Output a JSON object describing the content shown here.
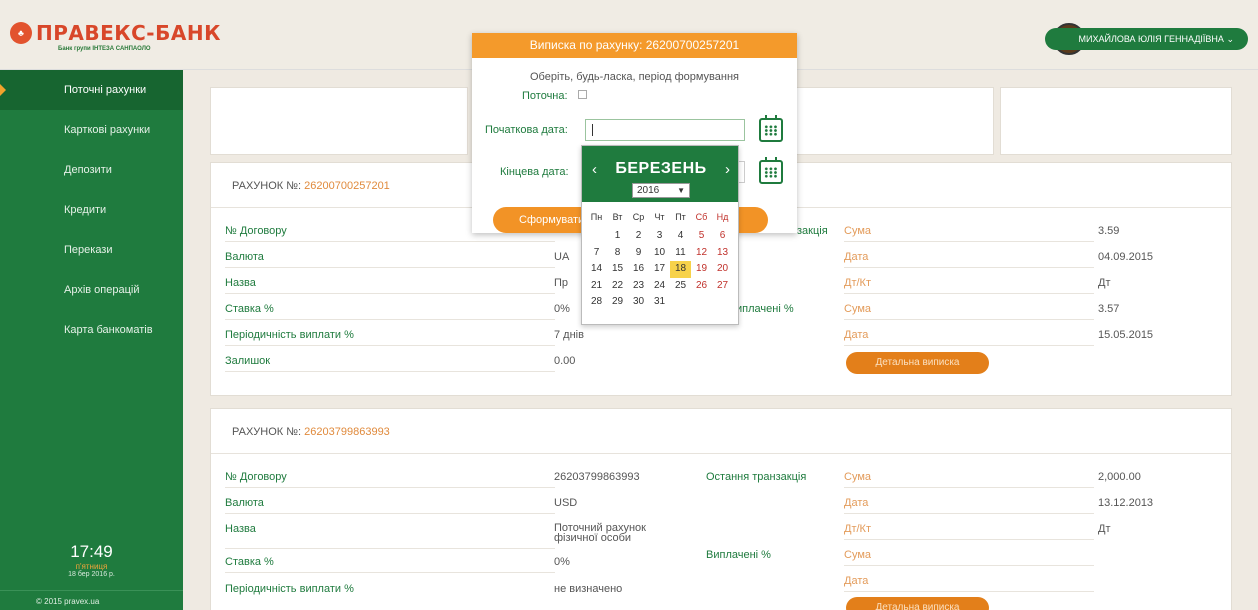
{
  "header": {
    "bank_name": "ПРАВЕКС-БАНК",
    "bank_tagline": "Банк групи ІНТЕЗА САНПАОЛО",
    "user_name": "МИХАЙЛОВА ЮЛІЯ ГЕННАДІЇВНА"
  },
  "sidebar": {
    "items": [
      {
        "label": "Поточні рахунки"
      },
      {
        "label": "Карткові рахунки"
      },
      {
        "label": "Депозити"
      },
      {
        "label": "Кредити"
      },
      {
        "label": "Перекази"
      },
      {
        "label": "Архів операцій"
      },
      {
        "label": "Карта банкоматів"
      }
    ],
    "clock_time": "17:49",
    "clock_day": "п'ятниця",
    "clock_date": "18 бер 2016 р.",
    "copyright": "© 2015 pravex.ua"
  },
  "accounts": [
    {
      "title": "РАХУНОК №:",
      "number": "26200700257201",
      "contract_label": "№ Договору",
      "currency_label": "Валюта",
      "currency_value": "UA",
      "name_label": "Назва",
      "name_value": "Пр",
      "rate_label": "Ставка %",
      "rate_value": "0%",
      "period_label": "Періодичність виплати %",
      "period_value": "7 днів",
      "balance_label": "Залишок",
      "balance_value": "0.00",
      "last_tx_label": "закція",
      "paid_label": "иплачені %",
      "sum_label": "Сума",
      "sum_value": "3.59",
      "date_label": "Дата",
      "date_value": "04.09.2015",
      "dtkt_label": "Дт/Кт",
      "dtkt_value": "Дт",
      "paid_sum_label": "Сума",
      "paid_sum_value": "3.57",
      "paid_date_label": "Дата",
      "paid_date_value": "15.05.2015",
      "detail_button": "Детальна виписка"
    },
    {
      "title": "РАХУНОК №:",
      "number": "26203799863993",
      "contract_label": "№ Договору",
      "contract_value": "26203799863993",
      "currency_label": "Валюта",
      "currency_value": "USD",
      "name_label": "Назва",
      "name_value_1": "Поточний рахунок",
      "name_value_2": "фізичної особи",
      "rate_label": "Ставка %",
      "rate_value": "0%",
      "period_label": "Періодичність виплати %",
      "period_value": "не визначено",
      "last_tx_label": "Остання транзакція",
      "paid_label": "Виплачені %",
      "sum_label": "Сума",
      "sum_value": "2,000.00",
      "date_label": "Дата",
      "date_value": "13.12.2013",
      "dtkt_label": "Дт/Кт",
      "dtkt_value": "Дт",
      "paid_sum_label": "Сума",
      "paid_date_label": "Дата",
      "detail_button": "Детальна виписка"
    }
  ],
  "modal": {
    "title": "Виписка по рахунку: 26200700257201",
    "subtitle": "Оберіть, будь-ласка, період формування",
    "current_label": "Поточна:",
    "start_label": "Початкова дата:",
    "end_label": "Кінцева дата:",
    "submit_label": "Сформувати"
  },
  "datepicker": {
    "month": "БЕРЕЗЕНЬ",
    "year": "2016",
    "weekdays": [
      "Пн",
      "Вт",
      "Ср",
      "Чт",
      "Пт",
      "Сб",
      "Нд"
    ],
    "days": [
      "",
      "1",
      "2",
      "3",
      "4",
      "5",
      "6",
      "7",
      "8",
      "9",
      "10",
      "11",
      "12",
      "13",
      "14",
      "15",
      "16",
      "17",
      "18",
      "19",
      "20",
      "21",
      "22",
      "23",
      "24",
      "25",
      "26",
      "27",
      "28",
      "29",
      "30",
      "31",
      "",
      "",
      ""
    ],
    "today": "18"
  },
  "colors": {
    "brand_green": "#1f7b3e",
    "brand_orange": "#f49a2b",
    "logo_red": "#d8472a"
  }
}
